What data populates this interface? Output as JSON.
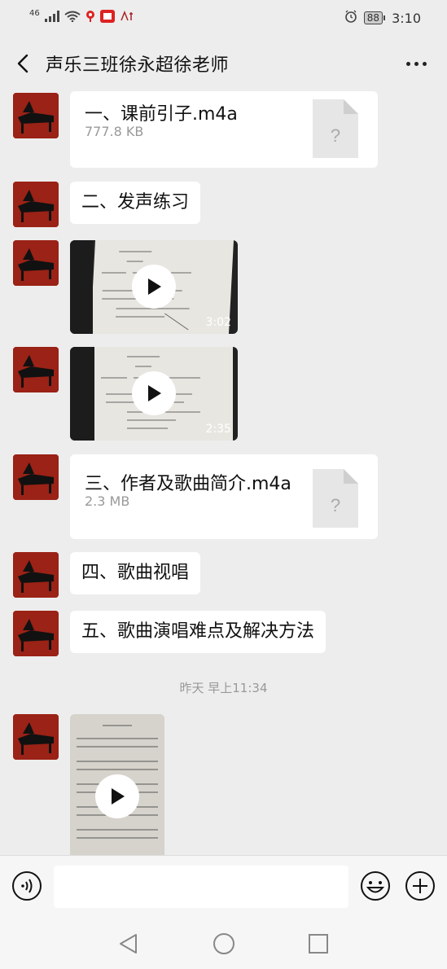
{
  "status_bar": {
    "network": "46",
    "battery": "88",
    "time": "3:10"
  },
  "header": {
    "title": "声乐三班徐永超徐老师"
  },
  "messages": [
    {
      "type": "file",
      "name": "一、课前引子.m4a",
      "size": "777.8 KB"
    },
    {
      "type": "text",
      "text": "二、发声练习"
    },
    {
      "type": "video",
      "duration": "3:02"
    },
    {
      "type": "video",
      "duration": "2:35"
    },
    {
      "type": "file",
      "name": "三、作者及歌曲简介.m4a",
      "size": "2.3 MB"
    },
    {
      "type": "text",
      "text": "四、歌曲视唱"
    },
    {
      "type": "text",
      "text": "五、歌曲演唱难点及解决方法"
    },
    {
      "type": "timestamp",
      "text": "昨天 早上11:34"
    },
    {
      "type": "video",
      "duration": ""
    }
  ],
  "input": {
    "placeholder": ""
  },
  "icons": {
    "back": "chevron-left-icon",
    "more": "more-dots-icon",
    "voice": "voice-icon",
    "emoji": "emoji-icon",
    "plus": "plus-icon",
    "file_unknown": "?"
  },
  "colors": {
    "background": "#ededed",
    "bubble": "#ffffff",
    "meta_text": "#999999"
  }
}
